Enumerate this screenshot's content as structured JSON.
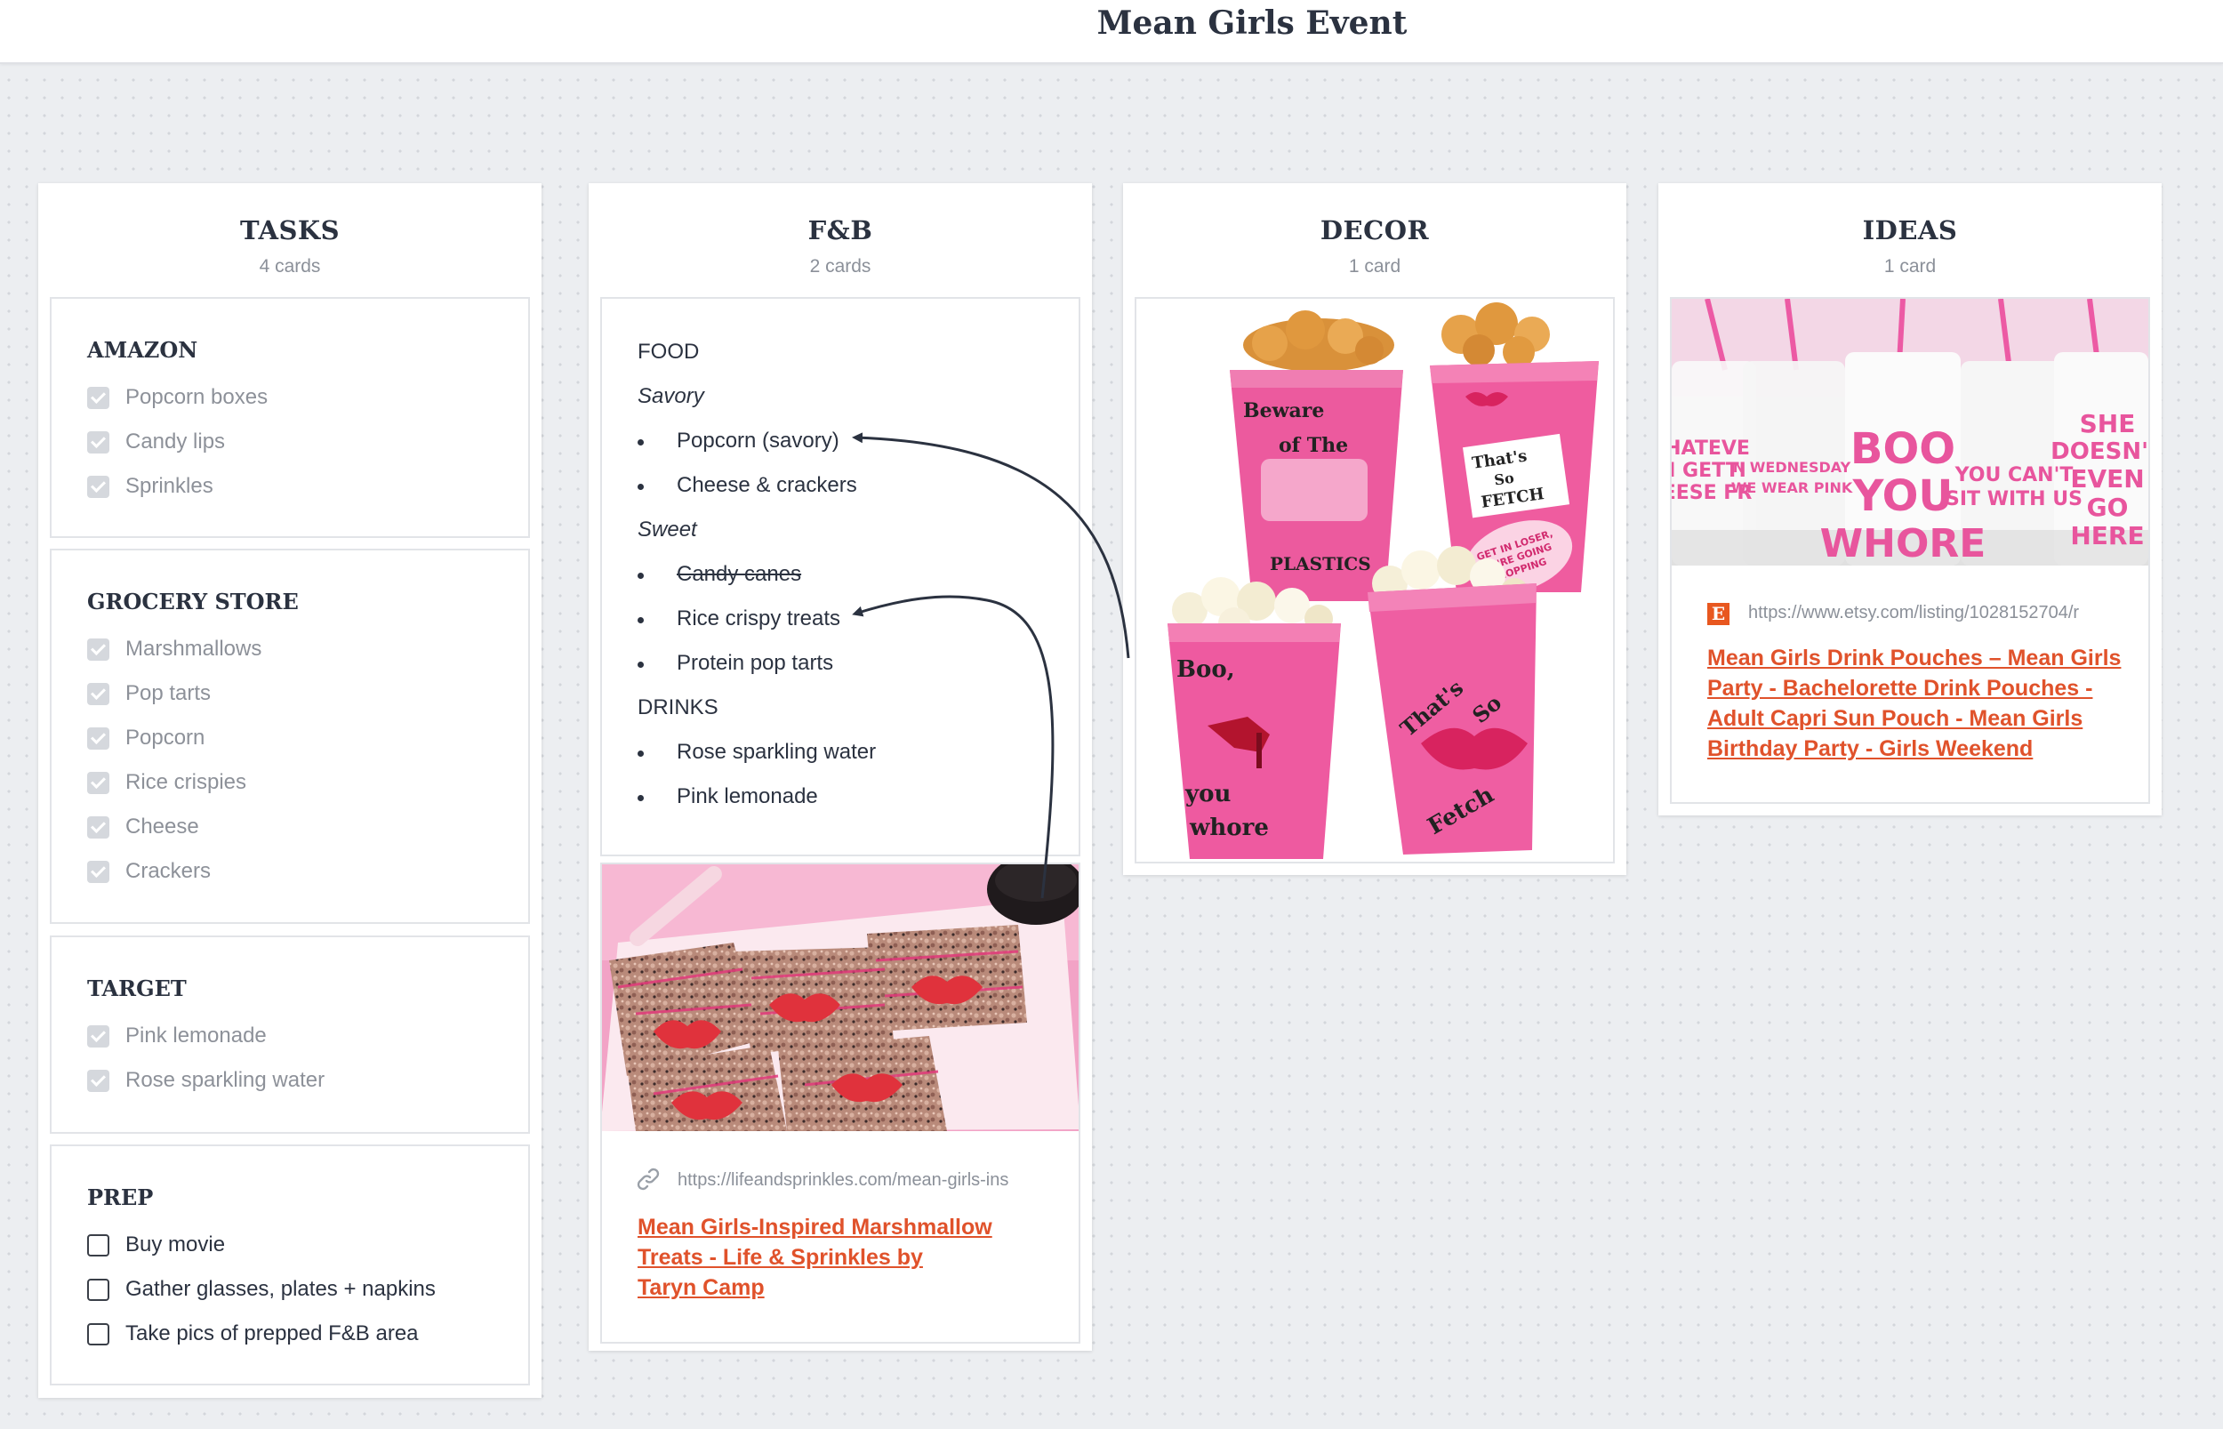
{
  "board": {
    "title": "Mean Girls Event"
  },
  "columns": {
    "tasks": {
      "title": "TASKS",
      "count": "4 cards",
      "cards": [
        {
          "heading": "AMAZON",
          "items": [
            {
              "label": "Popcorn boxes",
              "done": true
            },
            {
              "label": "Candy lips",
              "done": true
            },
            {
              "label": "Sprinkles",
              "done": true
            }
          ]
        },
        {
          "heading": "GROCERY STORE",
          "items": [
            {
              "label": "Marshmallows",
              "done": true
            },
            {
              "label": "Pop tarts",
              "done": true
            },
            {
              "label": "Popcorn",
              "done": true
            },
            {
              "label": "Rice crispies",
              "done": true
            },
            {
              "label": "Cheese",
              "done": true
            },
            {
              "label": "Crackers",
              "done": true
            }
          ]
        },
        {
          "heading": "TARGET",
          "items": [
            {
              "label": "Pink lemonade",
              "done": true
            },
            {
              "label": "Rose sparkling water",
              "done": true
            }
          ]
        },
        {
          "heading": "PREP",
          "items": [
            {
              "label": "Buy movie",
              "done": false
            },
            {
              "label": "Gather glasses, plates + napkins",
              "done": false
            },
            {
              "label": "Take pics of prepped F&B area",
              "done": false
            }
          ]
        }
      ]
    },
    "fb": {
      "title": "F&B",
      "count": "2 cards",
      "note": {
        "food_heading": "FOOD",
        "savory_heading": "Savory",
        "savory_items": [
          "Popcorn (savory)",
          "Cheese & crackers"
        ],
        "sweet_heading": "Sweet",
        "sweet_items": [
          "Candy canes",
          "Rice crispy treats",
          "Protein pop tarts"
        ],
        "drinks_heading": "DRINKS",
        "drinks_items": [
          "Rose sparkling water",
          "Pink lemonade"
        ]
      },
      "link_card": {
        "url": "https://lifeandsprinkles.com/mean-girls-ins",
        "title": "Mean Girls-Inspired Marshmallow Treats - Life & Sprinkles by Taryn Camp",
        "title_lines": [
          "Mean Girls-Inspired Marshmallow ",
          "Treats - Life & Sprinkles by ",
          "Taryn Camp"
        ]
      }
    },
    "decor": {
      "title": "DECOR",
      "count": "1 card",
      "image_text": {
        "box1": [
          "Beware",
          "of The",
          "PLASTICS"
        ],
        "box2": [
          "That's",
          "So",
          "FETCH",
          "GET IN LOSER,",
          "WE'RE GOING",
          "SHOPPING"
        ],
        "box3": [
          "Boo,",
          "you",
          "whore"
        ],
        "box4": [
          "That's",
          "So",
          "Fetch"
        ]
      }
    },
    "ideas": {
      "title": "IDEAS",
      "count": "1 card",
      "image_text": {
        "pouch1": [
          "HATEVE",
          "I GETTI",
          "EESE FR"
        ],
        "pouch2": [
          "N WEDNESDAY",
          "WE WEAR PINK"
        ],
        "pouch3": [
          "BOO",
          "YOU",
          "WHORE"
        ],
        "pouch4": [
          "YOU CAN'T",
          "SIT WITH US"
        ],
        "pouch5": [
          "SHE",
          "DOESN'T",
          "EVEN",
          "GO",
          "HERE"
        ]
      },
      "link_card": {
        "source_icon": "etsy-icon",
        "url": "https://www.etsy.com/listing/1028152704/r",
        "title": "Mean Girls Drink Pouches – Mean Girls Party - Bachelorette Drink Pouches - Adult Capri Sun Pouch - Mean Girls Birthday Party - Girls Weekend",
        "title_lines": [
          "Mean Girls Drink Pouches – Mean Girls ",
          "Party - Bachelorette Drink Pouches - ",
          "Adult Capri Sun Pouch - Mean Girls ",
          "Birthday Party - Girls Weekend"
        ]
      }
    }
  },
  "colors": {
    "accent_link": "#e0522b",
    "heading": "#2b3240",
    "muted": "#8b9099",
    "pink": "#ec4f9a"
  }
}
